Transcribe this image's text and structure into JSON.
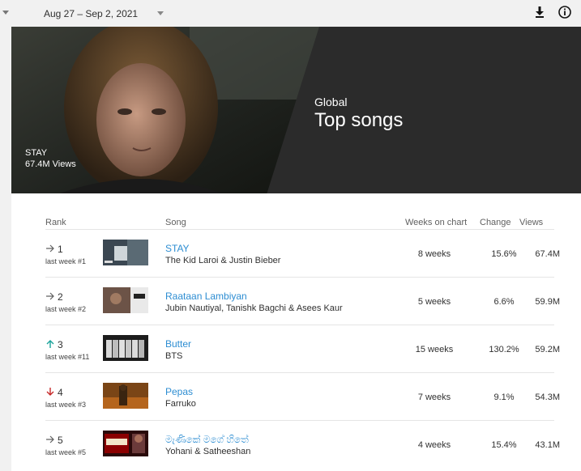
{
  "toolbar": {
    "date_range": "Aug 27 – Sep 2, 2021",
    "download_icon": "download-icon",
    "info_icon": "info-icon"
  },
  "hero": {
    "song": "STAY",
    "views": "67.4M Views",
    "region": "Global",
    "title": "Top songs"
  },
  "table": {
    "headers": {
      "rank": "Rank",
      "song": "Song",
      "weeks": "Weeks on chart",
      "change": "Change",
      "views": "Views"
    },
    "rows": [
      {
        "rank": "1",
        "trend": "same",
        "last_week": "last week #1",
        "title": "STAY",
        "artist": "The Kid Laroi & Justin Bieber",
        "weeks": "8 weeks",
        "change": "15.6%",
        "views": "67.4M"
      },
      {
        "rank": "2",
        "trend": "same",
        "last_week": "last week #2",
        "title": "Raataan Lambiyan",
        "artist": "Jubin Nautiyal, Tanishk Bagchi & Asees Kaur",
        "weeks": "5 weeks",
        "change": "6.6%",
        "views": "59.9M"
      },
      {
        "rank": "3",
        "trend": "up",
        "last_week": "last week #11",
        "title": "Butter",
        "artist": "BTS",
        "weeks": "15 weeks",
        "change": "130.2%",
        "views": "59.2M"
      },
      {
        "rank": "4",
        "trend": "down",
        "last_week": "last week #3",
        "title": "Pepas",
        "artist": "Farruko",
        "weeks": "7 weeks",
        "change": "9.1%",
        "views": "54.3M"
      },
      {
        "rank": "5",
        "trend": "same",
        "last_week": "last week #5",
        "title": "මැණිකේ මගේ හිතේ",
        "artist": "Yohani & Satheeshan",
        "weeks": "4 weeks",
        "change": "15.4%",
        "views": "43.1M"
      }
    ]
  },
  "colors": {
    "link": "#2d8dd2",
    "up": "#1aa39a",
    "down": "#c62828",
    "same": "#606060",
    "hero_bg": "#2b2b2b"
  }
}
